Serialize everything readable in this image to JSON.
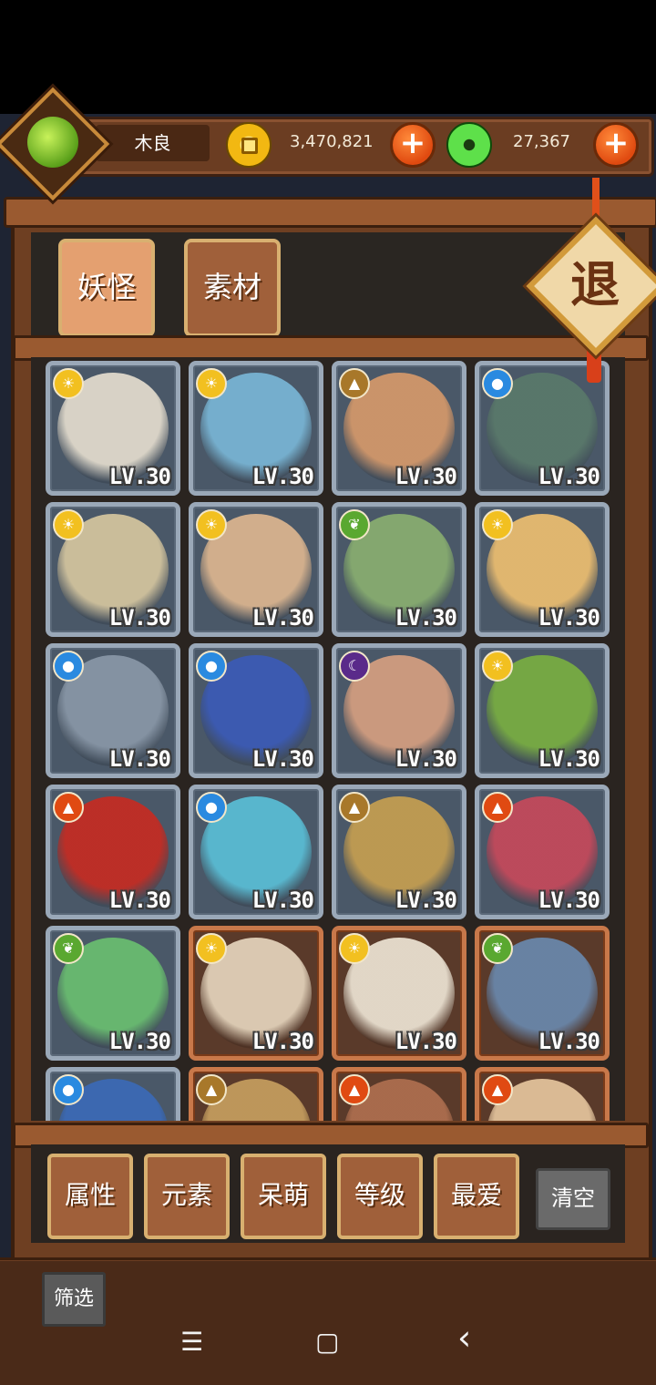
{
  "player": {
    "name": "木良"
  },
  "resources": {
    "coins": "3,470,821",
    "jade": "27,367",
    "add_label": "+"
  },
  "tabs": [
    {
      "label": "妖怪",
      "active": true
    },
    {
      "label": "素材",
      "active": false
    }
  ],
  "exit_label": "退",
  "level_label": "LV.30",
  "element_colors": {
    "sun": "#f2c020",
    "earth": "#a8782a",
    "water": "#2a8ae0",
    "leaf": "#5aa830",
    "moon": "#5a2a8a",
    "fire": "#e04a12"
  },
  "cards": [
    {
      "element": "sun",
      "portrait": "white-goose-with-soccer-ball",
      "level": "LV.30",
      "frame": "silver"
    },
    {
      "element": "sun",
      "portrait": "blue-dragon-horse",
      "level": "LV.30",
      "frame": "silver"
    },
    {
      "element": "earth",
      "portrait": "curly-haired-boy",
      "level": "LV.30",
      "frame": "silver"
    },
    {
      "element": "water",
      "portrait": "armored-crab-warrior",
      "level": "LV.30",
      "frame": "silver"
    },
    {
      "element": "sun",
      "portrait": "ram-spirit-with-shield",
      "level": "LV.30",
      "frame": "silver"
    },
    {
      "element": "sun",
      "portrait": "masked-girl",
      "level": "LV.30",
      "frame": "silver"
    },
    {
      "element": "leaf",
      "portrait": "old-sage-with-leaf",
      "level": "LV.30",
      "frame": "silver"
    },
    {
      "element": "sun",
      "portrait": "halo-fire-boy",
      "level": "LV.30",
      "frame": "silver"
    },
    {
      "element": "water",
      "portrait": "swordsman-in-armor",
      "level": "LV.30",
      "frame": "silver"
    },
    {
      "element": "water",
      "portrait": "blue-haired-maiden",
      "level": "LV.30",
      "frame": "silver"
    },
    {
      "element": "moon",
      "portrait": "bald-monk",
      "level": "LV.30",
      "frame": "silver"
    },
    {
      "element": "sun",
      "portrait": "green-parrot-goblin",
      "level": "LV.30",
      "frame": "silver"
    },
    {
      "element": "fire",
      "portrait": "red-maned-lion",
      "level": "LV.30",
      "frame": "silver"
    },
    {
      "element": "water",
      "portrait": "ice-crystal-girl",
      "level": "LV.30",
      "frame": "silver"
    },
    {
      "element": "earth",
      "portrait": "gold-crystal-girl",
      "level": "LV.30",
      "frame": "silver"
    },
    {
      "element": "fire",
      "portrait": "ruby-crystal-girl",
      "level": "LV.30",
      "frame": "silver"
    },
    {
      "element": "leaf",
      "portrait": "emerald-crystal-girl",
      "level": "LV.30",
      "frame": "silver"
    },
    {
      "element": "sun",
      "portrait": "bearded-sage",
      "level": "LV.30",
      "frame": "bronze"
    },
    {
      "element": "sun",
      "portrait": "white-rabbit-chef",
      "level": "LV.30",
      "frame": "bronze"
    },
    {
      "element": "leaf",
      "portrait": "one-eyed-lady",
      "level": "LV.30",
      "frame": "bronze"
    },
    {
      "element": "water",
      "portrait": "duck-and-cat",
      "level": "",
      "frame": "silver"
    },
    {
      "element": "earth",
      "portrait": "straw-hat-figure",
      "level": "",
      "frame": "bronze"
    },
    {
      "element": "fire",
      "portrait": "brown-haired-figure",
      "level": "",
      "frame": "bronze"
    },
    {
      "element": "fire",
      "portrait": "seal-stamp-figure",
      "level": "",
      "frame": "bronze"
    }
  ],
  "filters": [
    {
      "label": "属性"
    },
    {
      "label": "元素"
    },
    {
      "label": "呆萌"
    },
    {
      "label": "等级"
    },
    {
      "label": "最爱"
    }
  ],
  "clear_label": "清空",
  "screen_label": "筛选",
  "nav": {
    "menu": "☰",
    "home": "▢",
    "back": "‹"
  }
}
